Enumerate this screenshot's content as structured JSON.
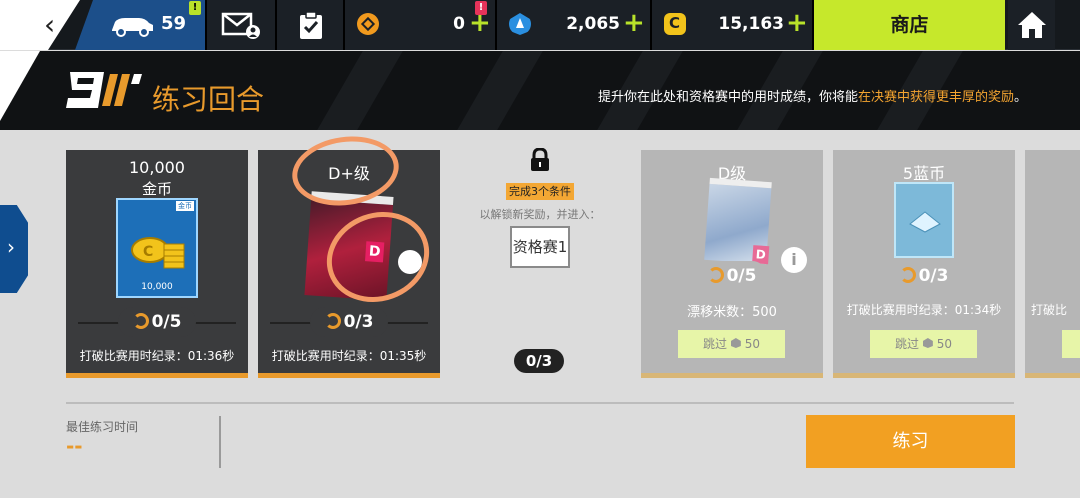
{
  "topbar": {
    "back_icon": "chevron-left",
    "garage_count": "59",
    "garage_alert": "!",
    "resources": [
      {
        "name": "tokens",
        "value": "0",
        "alert": "!",
        "color": "#f19a1e"
      },
      {
        "name": "credits",
        "value": "2,065",
        "color": "#2a8fe0"
      },
      {
        "name": "coins",
        "value": "15,163",
        "color": "#f2c31b"
      }
    ],
    "shop_label": "商店"
  },
  "header": {
    "title": "练习回合",
    "subtitle_prefix": "提升你在此处和资格赛中的用时成绩，你将能",
    "subtitle_highlight": "在决赛中获得更丰厚的奖励",
    "subtitle_suffix": "。"
  },
  "cards": [
    {
      "title_line1": "10,000",
      "title_line2": "金币",
      "thumb_caption": "10,000",
      "thumb_tag": "金币",
      "progress": "0/5",
      "requirement": "打破比赛用时纪录：01:36秒"
    },
    {
      "title_line1": "D+级",
      "progress": "0/3",
      "requirement": "打破比赛用时纪录：01:35秒",
      "badge": "D"
    },
    {
      "title_line1": "D级",
      "progress": "0/5",
      "requirement": "漂移米数：500",
      "skip_label": "跳过",
      "skip_cost": "50",
      "badge": "D"
    },
    {
      "title_line1": "5蓝币",
      "progress": "0/3",
      "requirement": "打破比赛用时纪录：01:34秒",
      "skip_label": "跳过",
      "skip_cost": "50"
    },
    {
      "requirement": "打破比"
    }
  ],
  "unlock": {
    "badge": "完成3个条件",
    "text": "以解锁新奖励，并进入：",
    "target": "资格赛1"
  },
  "pager": "0/3",
  "bottom": {
    "best_label": "最佳练习时间",
    "best_value": "--",
    "practice_button": "练习"
  }
}
